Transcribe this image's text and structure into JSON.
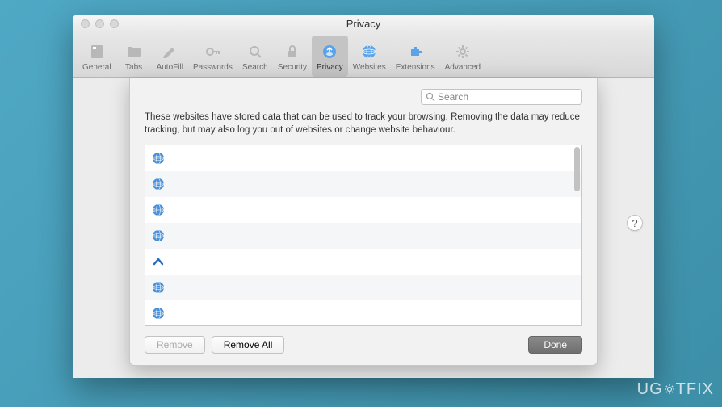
{
  "window": {
    "title": "Privacy"
  },
  "toolbar": {
    "items": [
      {
        "label": "General"
      },
      {
        "label": "Tabs"
      },
      {
        "label": "AutoFill"
      },
      {
        "label": "Passwords"
      },
      {
        "label": "Search"
      },
      {
        "label": "Security"
      },
      {
        "label": "Privacy"
      },
      {
        "label": "Websites"
      },
      {
        "label": "Extensions"
      },
      {
        "label": "Advanced"
      }
    ]
  },
  "sheet": {
    "search_placeholder": "Search",
    "description": "These websites have stored data that can be used to track your browsing. Removing the data may reduce tracking, but may also log you out of websites or change website behaviour.",
    "items": [
      {
        "icon": "globe"
      },
      {
        "icon": "globe"
      },
      {
        "icon": "globe"
      },
      {
        "icon": "globe"
      },
      {
        "icon": "caret"
      },
      {
        "icon": "globe"
      },
      {
        "icon": "globe"
      }
    ],
    "remove_label": "Remove",
    "remove_all_label": "Remove All",
    "done_label": "Done",
    "help_label": "?"
  },
  "watermark": "UG  TFIX"
}
